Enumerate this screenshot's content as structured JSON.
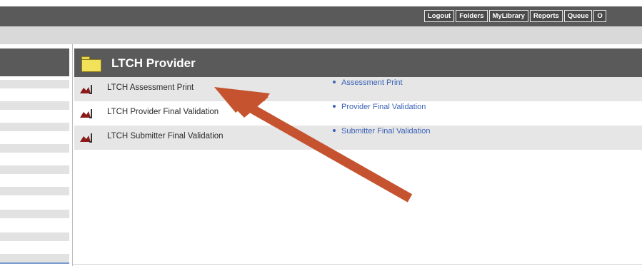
{
  "topnav": {
    "buttons": [
      "Logout",
      "Folders",
      "MyLibrary",
      "Reports",
      "Queue",
      "O"
    ]
  },
  "main": {
    "title": "LTCH Provider",
    "items": [
      {
        "label": "LTCH Assessment Print",
        "link": "Assessment Print"
      },
      {
        "label": "LTCH Provider Final Validation",
        "link": "Provider Final Validation"
      },
      {
        "label": "LTCH Submitter Final Validation",
        "link": "Submitter Final Validation"
      }
    ]
  },
  "colors": {
    "header_bg": "#5a5a5a",
    "subbar_bg": "#d9d9d9",
    "row_alt_bg": "#e6e6e6",
    "link": "#3b62b6",
    "annotation_arrow": "#c5532f",
    "folder": "#f2e25a"
  },
  "icons": {
    "folder": "folder-icon",
    "report": "report-icon",
    "annotation": "arrow-annotation"
  }
}
